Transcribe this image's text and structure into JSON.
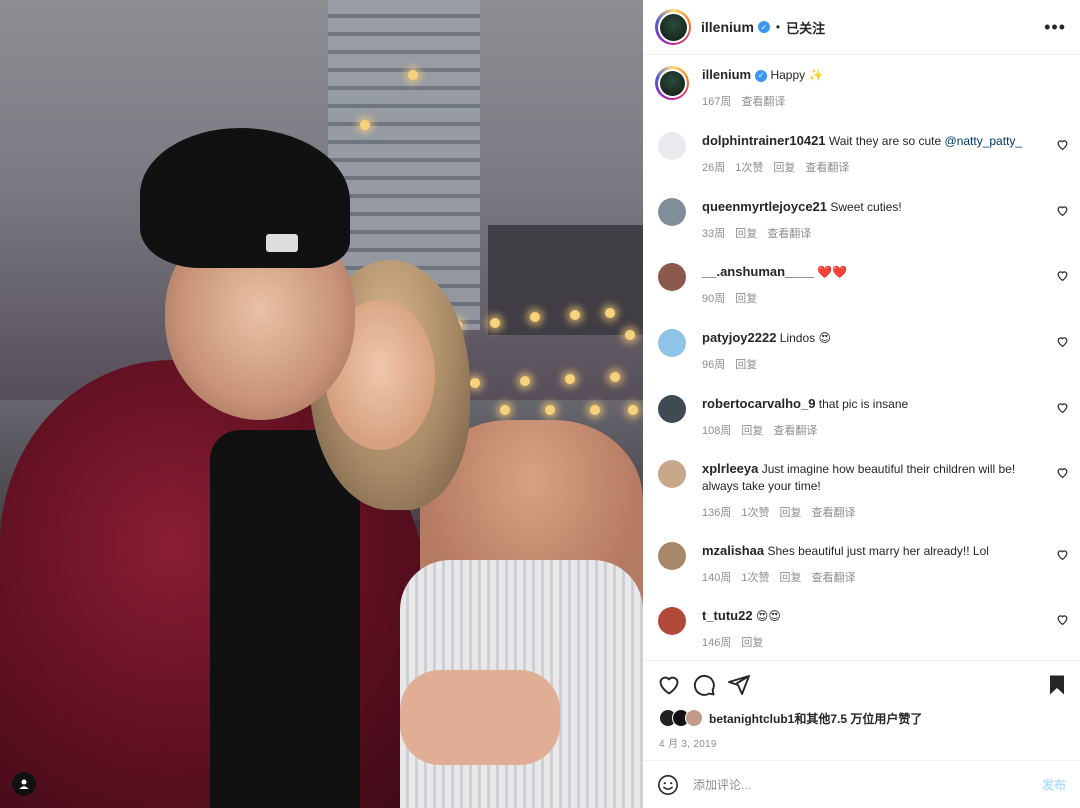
{
  "header": {
    "username": "illenium",
    "follow_status": "已关注",
    "dot": "•",
    "more": "•••"
  },
  "caption": {
    "username": "illenium",
    "text": "Happy",
    "emoji": "✨",
    "time": "167周",
    "translate": "查看翻译"
  },
  "comments": [
    {
      "username": "dolphintrainer10421",
      "text": "Wait they are so cute",
      "mention": "@natty_patty_",
      "time": "26周",
      "likes": "1次赞",
      "reply": "回复",
      "translate": "查看翻译",
      "avatar_color": "#e9e9ee"
    },
    {
      "username": "queenmyrtlejoyce21",
      "text": "Sweet cuties!",
      "time": "33周",
      "reply": "回复",
      "translate": "查看翻译",
      "avatar_color": "#7f8f97"
    },
    {
      "username": "__.anshuman____",
      "text": "❤️❤️",
      "time": "90周",
      "reply": "回复",
      "avatar_color": "#8c5a4c"
    },
    {
      "username": "patyjoy2222",
      "text": "Lindos 😍",
      "time": "96周",
      "reply": "回复",
      "avatar_color": "#8fc4e8"
    },
    {
      "username": "robertocarvalho_9",
      "text": "that pic is insane",
      "time": "108周",
      "reply": "回复",
      "translate": "查看翻译",
      "avatar_color": "#3f4a52"
    },
    {
      "username": "xplrleeya",
      "text": "Just imagine how beautiful their children will be! always take your time!",
      "time": "136周",
      "likes": "1次赞",
      "reply": "回复",
      "translate": "查看翻译",
      "avatar_color": "#c9a78a"
    },
    {
      "username": "mzalishaa",
      "text": "Shes beautiful just marry her already!! Lol",
      "time": "140周",
      "likes": "1次赞",
      "reply": "回复",
      "translate": "查看翻译",
      "avatar_color": "#a9876b"
    },
    {
      "username": "t_tutu22",
      "text": "😍😍",
      "time": "146周",
      "reply": "回复",
      "avatar_color": "#b14a3a"
    }
  ],
  "likes_summary": "betanightclub1和其他7.5 万位用户赞了",
  "date": "4 月 3, 2019",
  "add_comment": {
    "placeholder": "添加评论...",
    "post_label": "发布"
  },
  "colors": {
    "accent": "#3897f0",
    "muted": "#8e8e8e",
    "post_disabled": "#b2dffc",
    "jacket": "#8a1d33"
  }
}
